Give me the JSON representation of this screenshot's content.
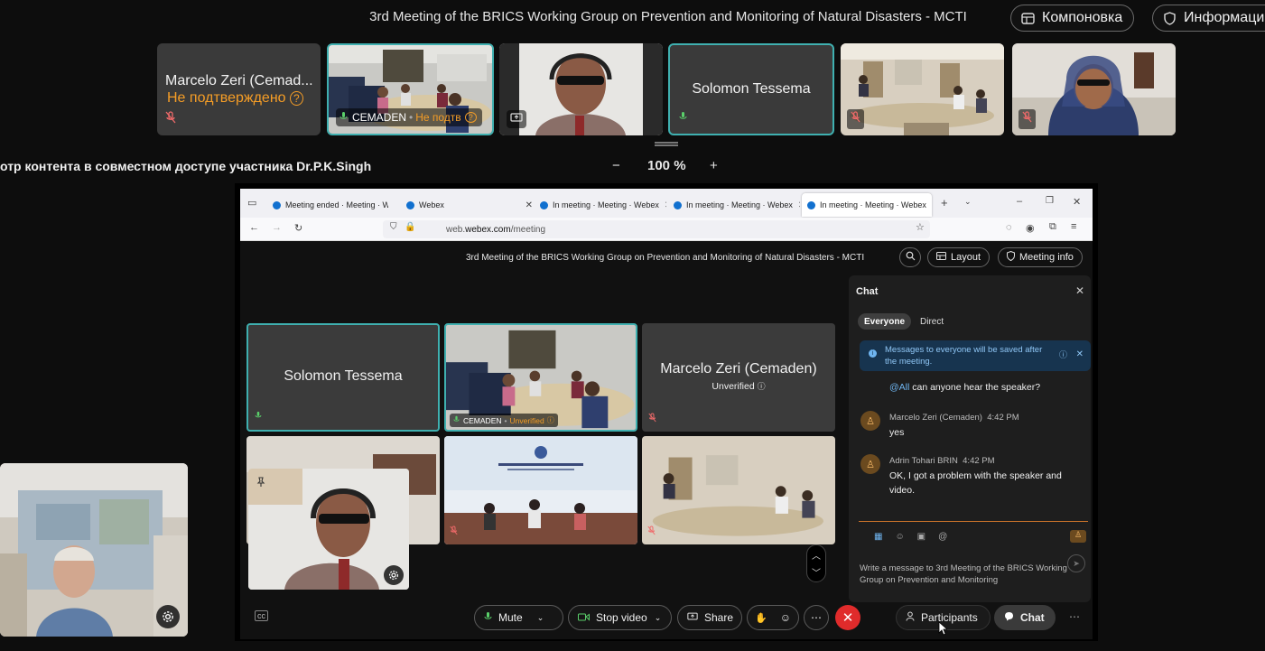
{
  "meeting": {
    "title": "3rd Meeting of the BRICS Working Group on Prevention and Monitoring of Natural Disasters - MCTI",
    "layout_label": "Компоновка",
    "info_label": "Информаци"
  },
  "tiles": [
    {
      "name": "Marcelo Zeri (Cemad...",
      "status": "Не подтверждено"
    },
    {
      "name": "CEMADEN",
      "status": "Не подтв"
    },
    {
      "name": ""
    },
    {
      "name": "Solomon Tessema"
    },
    {
      "name": ""
    },
    {
      "name": ""
    }
  ],
  "share": {
    "label": "отр контента в совместном доступе участника Dr.P.K.Singh",
    "zoom": "100 %",
    "zoom_minus": "−",
    "zoom_plus": "+"
  },
  "browser": {
    "tabs": [
      {
        "label": "Meeting ended · Meeting · W"
      },
      {
        "label": "Webex"
      },
      {
        "label": "In meeting · Meeting · Webex"
      },
      {
        "label": "In meeting · Meeting · Webex"
      },
      {
        "label": "In meeting · Meeting · Webex"
      }
    ],
    "url_domain": "web.",
    "url_host": "webex.com",
    "url_path": "/meeting"
  },
  "inner": {
    "title": "3rd Meeting of the BRICS Working Group on Prevention and Monitoring of Natural Disasters - MCTI",
    "layout_label": "Layout",
    "meeting_info_label": "Meeting info",
    "tiles": [
      {
        "name": "Solomon Tessema"
      },
      {
        "name": "CEMADEN",
        "status": "Unverified"
      },
      {
        "name": "Marcelo Zeri (Cemaden)",
        "status": "Unverified"
      }
    ]
  },
  "chat": {
    "title": "Chat",
    "tab_everyone": "Everyone",
    "tab_direct": "Direct",
    "info_text": "Messages to everyone will be saved after the meeting.",
    "messages": [
      {
        "mention": "@All",
        "text": " can anyone hear the speaker?"
      },
      {
        "author": "Marcelo Zeri (Cemaden)",
        "time": "4:42 PM",
        "text": "yes"
      },
      {
        "author": "Adrin Tohari BRIN",
        "time": "4:42 PM",
        "text": "OK, I got a problem with the speaker and video."
      }
    ],
    "input_placeholder": "Write a message to 3rd Meeting of the BRICS Working Group on Prevention and Monitoring"
  },
  "toolbar": {
    "mute": "Mute",
    "stop_video": "Stop video",
    "share": "Share",
    "participants": "Participants",
    "chat": "Chat"
  },
  "colors": {
    "unverified": "#f59d26",
    "active_border": "#3fb0b0",
    "end_call": "#e02b2b"
  }
}
